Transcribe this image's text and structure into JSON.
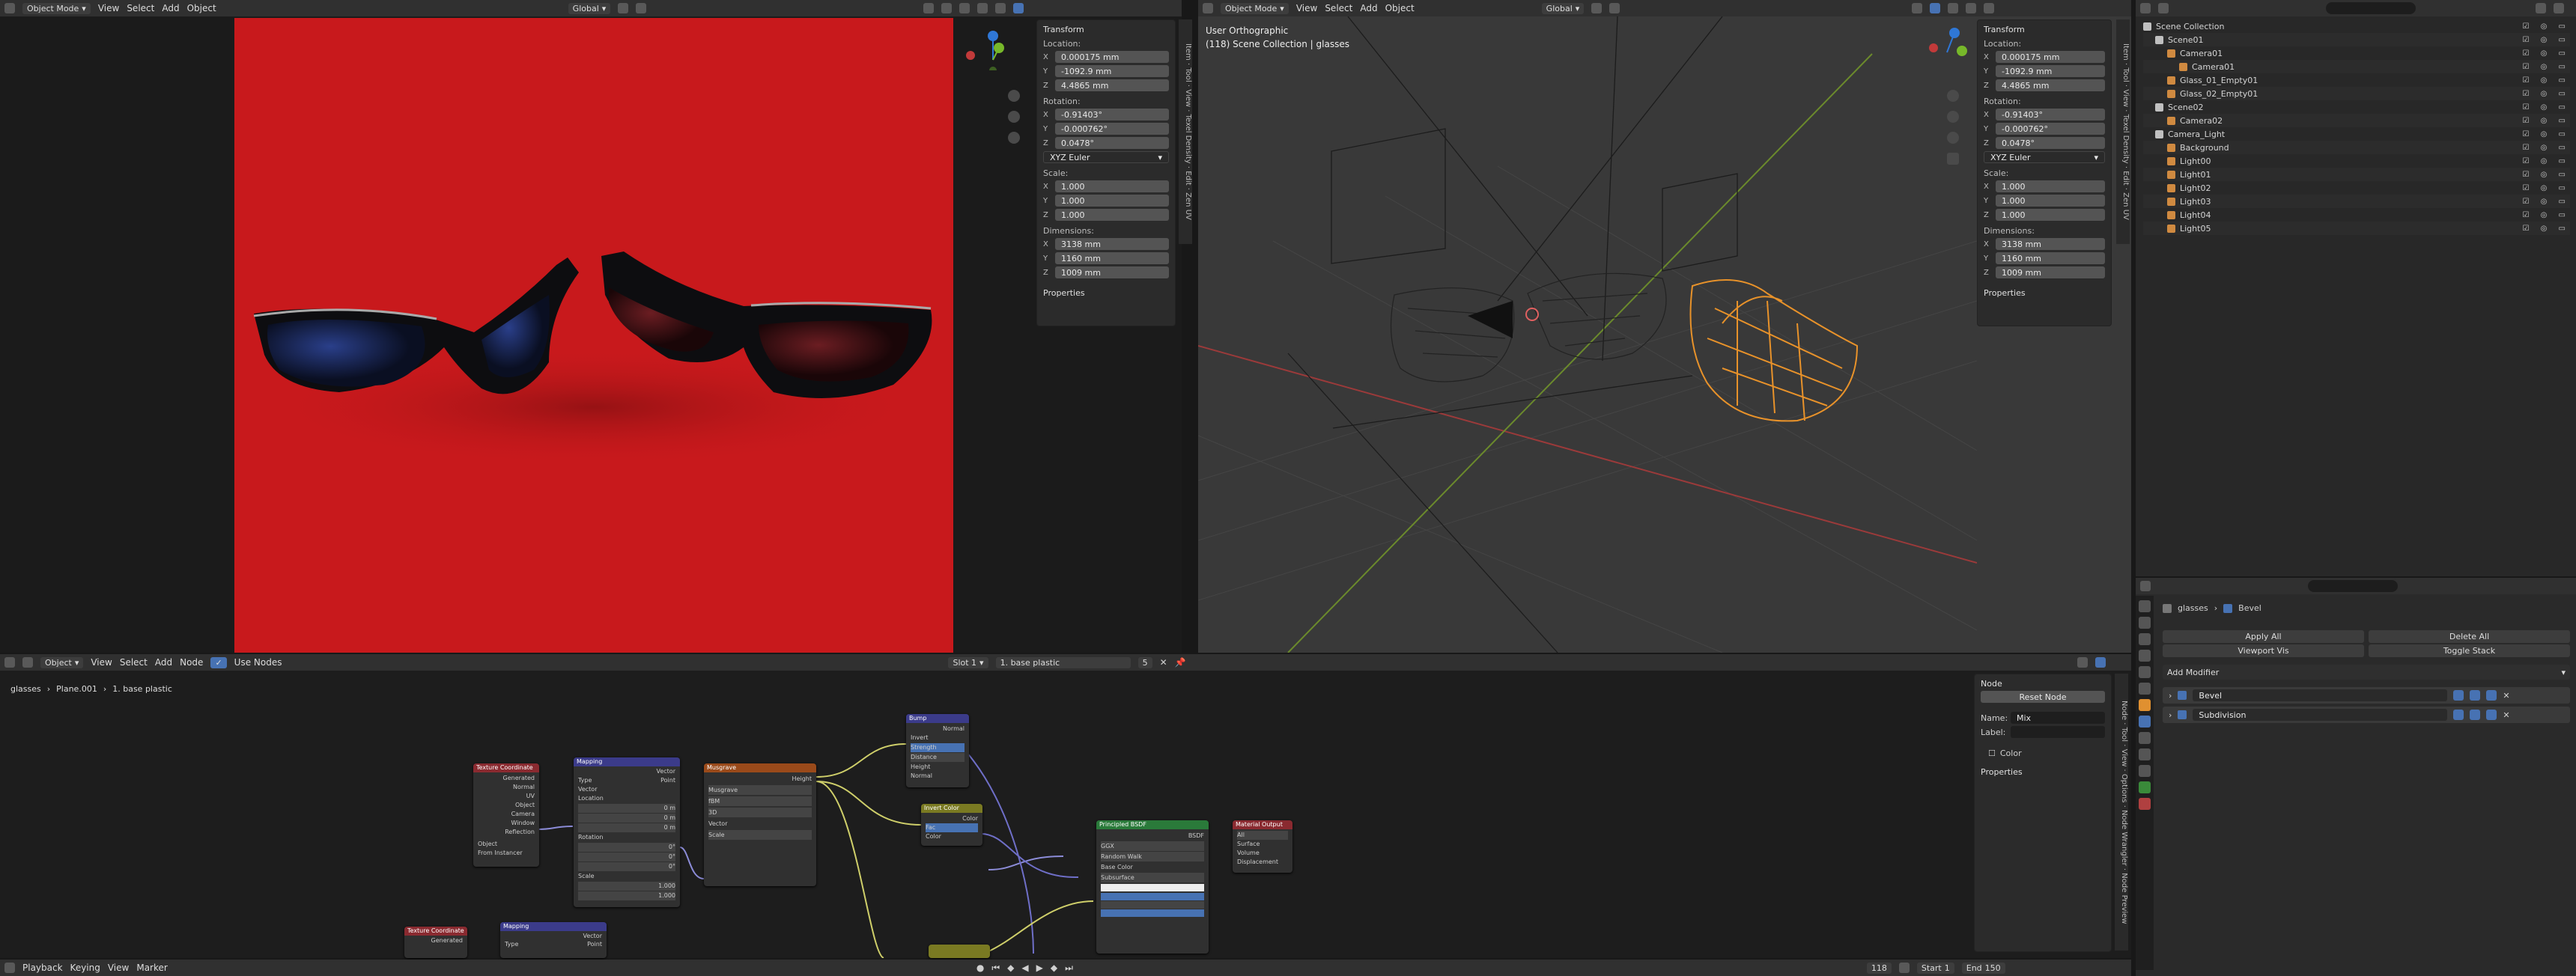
{
  "viewport_left": {
    "mode": "Object Mode",
    "menus": [
      "View",
      "Select",
      "Add",
      "Object"
    ],
    "orientation": "Global"
  },
  "viewport_right": {
    "mode": "Object Mode",
    "menus": [
      "View",
      "Select",
      "Add",
      "Object"
    ],
    "orientation": "Global",
    "overlay_title": "User Orthographic",
    "overlay_sub": "(118) Scene Collection | glasses"
  },
  "transform": {
    "title": "Transform",
    "location_label": "Location:",
    "location": {
      "x": "0.000175 mm",
      "y": "-1092.9 mm",
      "z": "4.4865 mm"
    },
    "rotation_label": "Rotation:",
    "rotation": {
      "x": "-0.91403°",
      "y": "-0.000762°",
      "z": "0.0478°"
    },
    "rotation_mode": "XYZ Euler",
    "scale_label": "Scale:",
    "scale": {
      "x": "1.000",
      "y": "1.000",
      "z": "1.000"
    },
    "dimensions_label": "Dimensions:",
    "dimensions": {
      "x": "3138 mm",
      "y": "1160 mm",
      "z": "1009 mm"
    },
    "properties": "Properties"
  },
  "axis_labels": {
    "x": "X",
    "y": "Y",
    "z": "Z"
  },
  "side_tabs": [
    "Item",
    "Tool",
    "View",
    "Texel Density",
    "Edit",
    "Zen UV"
  ],
  "node_tabs": [
    "Node",
    "Tool",
    "View",
    "Options",
    "Node Wrangler",
    "Node Preview"
  ],
  "outliner": {
    "items": [
      {
        "label": "Scene Collection",
        "indent": 0
      },
      {
        "label": "Scene01",
        "indent": 1
      },
      {
        "label": "Camera01",
        "indent": 2
      },
      {
        "label": "Camera01",
        "indent": 3
      },
      {
        "label": "Glass_01_Empty01",
        "indent": 2
      },
      {
        "label": "Glass_02_Empty01",
        "indent": 2
      },
      {
        "label": "Scene02",
        "indent": 1
      },
      {
        "label": "Camera02",
        "indent": 2
      },
      {
        "label": "Camera_Light",
        "indent": 1
      },
      {
        "label": "Background",
        "indent": 2
      },
      {
        "label": "Light00",
        "indent": 2
      },
      {
        "label": "Light01",
        "indent": 2
      },
      {
        "label": "Light02",
        "indent": 2
      },
      {
        "label": "Light03",
        "indent": 2
      },
      {
        "label": "Light04",
        "indent": 2
      },
      {
        "label": "Light05",
        "indent": 2
      }
    ]
  },
  "properties": {
    "breadcrumb_obj": "glasses",
    "breadcrumb_mod": "Bevel",
    "apply_all": "Apply All",
    "delete_all": "Delete All",
    "viewport_vis": "Viewport Vis",
    "toggle_stack": "Toggle Stack",
    "add_modifier": "Add Modifier",
    "modifiers": [
      "Bevel",
      "Subdivision"
    ]
  },
  "node_editor": {
    "editor": "Object",
    "menus": [
      "View",
      "Select",
      "Add",
      "Node"
    ],
    "use_nodes": "Use Nodes",
    "slot": "Slot 1",
    "material": "1. base plastic",
    "users": "5",
    "breadcrumb": [
      "glasses",
      "Plane.001",
      "1. base plastic"
    ],
    "node_panel_title": "Node",
    "reset_node": "Reset Node",
    "name_label": "Name:",
    "name_value": "Mix",
    "label_label": "Label:",
    "color": "Color",
    "properties": "Properties",
    "nodes": {
      "tex1": "Texture Coordinate",
      "map1": "Mapping",
      "tex2": "Texture Coordinate",
      "map2": "Mapping",
      "musgrave": "Musgrave",
      "bump": "Bump",
      "invert": "Invert Color",
      "bsdf": "Principled BSDF",
      "output": "Material Output"
    },
    "node_texts": {
      "generated": "Generated",
      "normal": "Normal",
      "uv": "UV",
      "object": "Object",
      "camera": "Camera",
      "window": "Window",
      "reflection": "Reflection",
      "from_instancer": "From Instancer",
      "vector": "Vector",
      "type": "Type",
      "type_value": "Point",
      "location": "Location",
      "rotation": "Rotation",
      "scale": "Scale",
      "zero_m": "0 m",
      "zero_deg": "0°",
      "one": "1.000",
      "fbm": "fBM",
      "three_d": "3D",
      "height": "Height",
      "strength": "Strength",
      "distance": "Distance",
      "invert": "Invert",
      "fac": "Fac",
      "color": "Color",
      "bsdf": "BSDF",
      "ggx": "GGX",
      "random_walk": "Random Walk",
      "base_color": "Base Color",
      "subsurface": "Subsurface",
      "all": "All",
      "surface": "Surface",
      "volume": "Volume",
      "displacement": "Displacement"
    }
  },
  "timeline": {
    "menus": [
      "Playback",
      "Keying",
      "View",
      "Marker"
    ],
    "frame": "118",
    "start_label": "Start",
    "start": "1",
    "end_label": "End",
    "end": "150"
  },
  "colors": {
    "red_bg": "#c8191c",
    "selection": "#f0a030",
    "accent": "#4772b3"
  }
}
